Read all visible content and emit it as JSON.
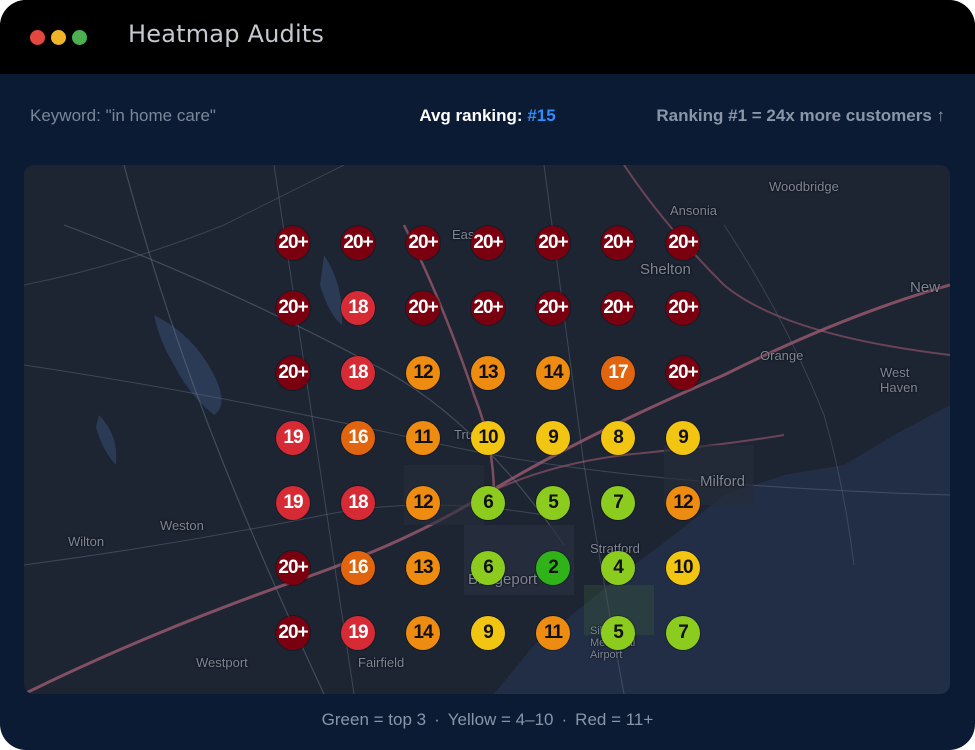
{
  "window": {
    "title": "Heatmap Audits"
  },
  "info": {
    "keyword": "Keyword: \"in home care\"",
    "avg_label": "Avg ranking: ",
    "avg_value": "#15",
    "promo": "Ranking #1 = 24x more customers ↑"
  },
  "map": {
    "places": [
      "Woodbridge",
      "Ansonia",
      "Shelton",
      "New",
      "Orange",
      "West Haven",
      "Milford",
      "Trumbull",
      "Easton",
      "Weston",
      "Wilton",
      "Stratford",
      "Bridgeport",
      "Westport",
      "Fairfield",
      "Sikorsky Memorial Airport"
    ],
    "grid": [
      [
        "20+",
        "20+",
        "20+",
        "20+",
        "20+",
        "20+",
        "20+"
      ],
      [
        "20+",
        "18",
        "20+",
        "20+",
        "20+",
        "20+",
        "20+"
      ],
      [
        "20+",
        "18",
        "12",
        "13",
        "14",
        "17",
        "20+"
      ],
      [
        "19",
        "16",
        "11",
        "10",
        "9",
        "8",
        "9"
      ],
      [
        "19",
        "18",
        "12",
        "6",
        "5",
        "7",
        "12"
      ],
      [
        "20+",
        "16",
        "13",
        "6",
        "2",
        "4",
        "10"
      ],
      [
        "20+",
        "19",
        "14",
        "9",
        "11",
        "5",
        "7"
      ]
    ]
  },
  "legend": {
    "green": "Green = top 3",
    "yellow": "Yellow = 4–10",
    "red": "Red = 11+",
    "separator": "·"
  },
  "colors": {
    "accent": "#2f8cff",
    "rank_20plus": "#7a0010",
    "rank_18_19": "#d62b35",
    "rank_16_17": "#e0650e",
    "rank_11_15": "#ee8c12",
    "rank_8_10": "#f2c512",
    "rank_4_7": "#8ccc1f",
    "rank_1_3": "#2fb318"
  }
}
